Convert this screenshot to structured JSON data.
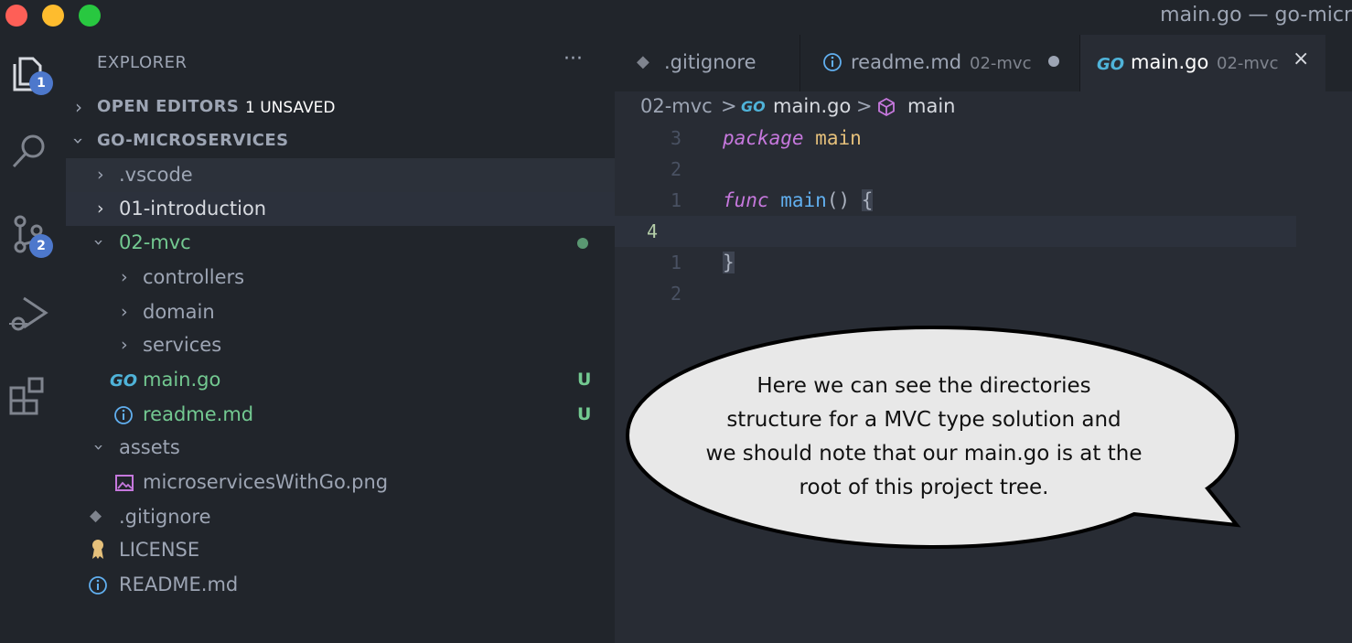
{
  "window": {
    "title": "main.go — go-micr"
  },
  "activity_bar": {
    "explorer_badge": "1",
    "scm_badge": "2"
  },
  "sidebar": {
    "title": "EXPLORER",
    "more": "···",
    "open_editors": {
      "label": "OPEN EDITORS",
      "extra": "1 UNSAVED"
    },
    "project": {
      "label": "GO-MICROSERVICES"
    },
    "tree": [
      {
        "name": ".vscode"
      },
      {
        "name": "01-introduction"
      },
      {
        "name": "02-mvc"
      },
      {
        "name": "controllers"
      },
      {
        "name": "domain"
      },
      {
        "name": "services"
      },
      {
        "name": "main.go",
        "status": "U"
      },
      {
        "name": "readme.md",
        "status": "U"
      },
      {
        "name": "assets"
      },
      {
        "name": "microservicesWithGo.png"
      },
      {
        "name": ".gitignore"
      },
      {
        "name": "LICENSE"
      },
      {
        "name": "README.md"
      }
    ],
    "go_logo": "GO"
  },
  "tabs": [
    {
      "name": ".gitignore",
      "dir": ""
    },
    {
      "name": "readme.md",
      "dir": "02-mvc"
    },
    {
      "name": "main.go",
      "dir": "02-mvc",
      "close": "×"
    }
  ],
  "breadcrumb": {
    "folder": "02-mvc",
    "file": "main.go",
    "symbol": "main",
    "sep": ">"
  },
  "editor": {
    "lines": [
      {
        "num": "3",
        "kw": "package",
        "rest": "main"
      },
      {
        "num": "2"
      },
      {
        "num": "1",
        "kw": "func",
        "fn": "main",
        "paren": "() ",
        "brace": "{"
      },
      {
        "num": "4"
      },
      {
        "num": "1",
        "brace": "}"
      },
      {
        "num": "2"
      }
    ]
  },
  "callout": {
    "line1": "Here we can see the directories",
    "line2": "structure for a MVC type solution and",
    "line3": "we should note that our main.go is at the",
    "line4": "root of this project tree."
  },
  "colors": {
    "accent": "#4d78cc",
    "untracked_green": "#73c991",
    "go_blue": "#4fb3d9"
  }
}
